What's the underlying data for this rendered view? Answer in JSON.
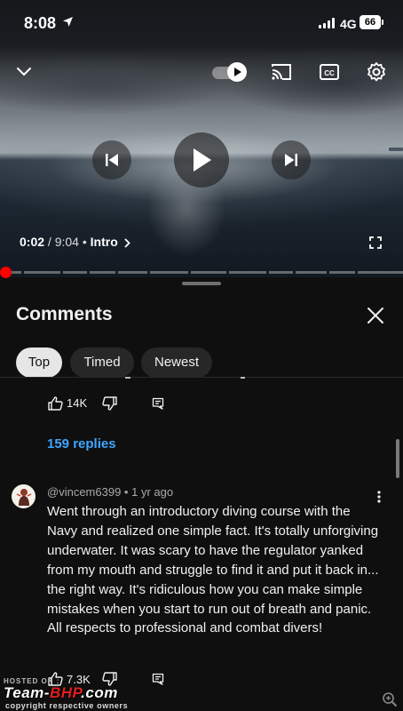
{
  "status_bar": {
    "time": "8:08",
    "network": "4G",
    "battery": "66"
  },
  "player": {
    "current_time": "0:02",
    "separator": "/",
    "duration": "9:04",
    "bullet": "•",
    "chapter": "Intro",
    "progress_fraction": 0.004,
    "autoplay_on": true
  },
  "comments": {
    "title": "Comments",
    "chips": [
      {
        "label": "Top",
        "active": true
      },
      {
        "label": "Timed",
        "active": false
      },
      {
        "label": "Newest",
        "active": false
      }
    ],
    "first": {
      "likes": "14K",
      "replies_label": "159 replies"
    },
    "second": {
      "author": "@vincem6399",
      "bullet": "•",
      "age": "1 yr ago",
      "text": "Went through an introductory diving course with the Navy and realized one simple fact. It's totally unforgiving underwater. It was scary to have the regulator yanked from my mouth and struggle to find it and put it back in... the right way. It's ridiculous how you can make simple mistakes when you start to run out of breath and panic. All respects to professional and combat divers!",
      "likes": "7.3K"
    }
  },
  "watermark": {
    "hosted": "HOSTED ON :",
    "logo_prefix": "Team-",
    "logo_brand": "BHP",
    "logo_suffix": ".com",
    "copyright": "copyright respective owners"
  },
  "colors": {
    "accent_red": "#ff0000",
    "link_blue": "#3ea6ff",
    "background": "#0f0f0f"
  }
}
